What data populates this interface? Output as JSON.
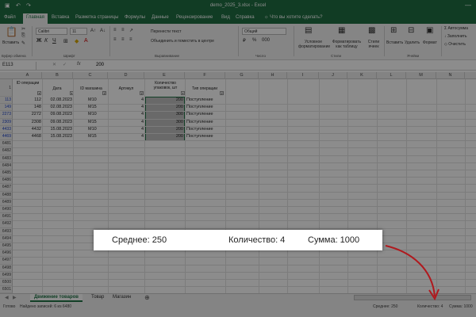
{
  "window": {
    "title": "demo_2025_3.xlsx  -  Excel",
    "minimize": "—"
  },
  "ribbon_tabs": [
    "Файл",
    "Главная",
    "Вставка",
    "Разметка страницы",
    "Формулы",
    "Данные",
    "Рецензирование",
    "Вид",
    "Справка"
  ],
  "tell_me": "Что вы хотите сделать?",
  "ribbon": {
    "paste": "Вставить",
    "font_name": "Calibri",
    "font_size": "11",
    "wrap_text": "Перенести текст",
    "merge": "Объединить и поместить в центре",
    "number_format": "Общий",
    "conditional": "Условное форматирование",
    "format_table": "Форматировать как таблицу",
    "cell_styles": "Стили ячеек",
    "insert": "Вставить",
    "delete": "Удалить",
    "format": "Формат",
    "autosum": "Автосумма",
    "fill": "Заполнить",
    "clear": "Очистить",
    "groups": {
      "clipboard": "Буфер обмена",
      "font": "Шрифт",
      "alignment": "Выравнивание",
      "number": "Число",
      "styles": "Стили",
      "cells": "Ячейки"
    }
  },
  "formula_bar": {
    "name_box": "E113",
    "fx": "fx",
    "value": "200"
  },
  "columns": [
    "A",
    "B",
    "C",
    "D",
    "E",
    "F",
    "G",
    "H",
    "I",
    "J",
    "K",
    "L",
    "M",
    "N",
    "O",
    "P"
  ],
  "headers": {
    "a": "ID операции",
    "b": "Дата",
    "c": "ID магазина",
    "d": "Артикул",
    "e": "Количество упаковок, шт",
    "f": "Тип операции"
  },
  "rows": [
    {
      "num": "113",
      "a": "112",
      "b": "02.08.2023",
      "c": "M10",
      "d": "4",
      "e": "200",
      "f": "Поступление"
    },
    {
      "num": "149",
      "a": "148",
      "b": "02.08.2023",
      "c": "M15",
      "d": "4",
      "e": "200",
      "f": "Поступление"
    },
    {
      "num": "2273",
      "a": "2272",
      "b": "09.08.2023",
      "c": "M10",
      "d": "4",
      "e": "300",
      "f": "Поступление"
    },
    {
      "num": "2309",
      "a": "2308",
      "b": "09.08.2023",
      "c": "M15",
      "d": "4",
      "e": "300",
      "f": "Поступление"
    },
    {
      "num": "4433",
      "a": "4432",
      "b": "15.08.2023",
      "c": "M10",
      "d": "4",
      "e": "200",
      "f": "Поступление"
    },
    {
      "num": "4469",
      "a": "4468",
      "b": "15.08.2023",
      "c": "M15",
      "d": "4",
      "e": "200",
      "f": "Поступление"
    }
  ],
  "empty_rows": [
    "6481",
    "6482",
    "6483",
    "6484",
    "6485",
    "6486",
    "6487",
    "6488",
    "6489",
    "6490",
    "6491",
    "6492",
    "6493",
    "6494",
    "6495",
    "6496",
    "6497",
    "6498",
    "6499",
    "6500",
    "6501",
    "6502",
    "6503"
  ],
  "sheet_tabs": [
    "Движение товаров",
    "Товар",
    "Магазин"
  ],
  "status": {
    "ready": "Готово",
    "found": "Найдено записей: 6 из 6480",
    "average": "Среднее: 250",
    "count": "Количество: 4",
    "sum": "Сумма: 1000"
  },
  "zoom_panel": {
    "average": "Среднее: 250",
    "count": "Количество: 4",
    "sum": "Сумма: 1000"
  },
  "colors": {
    "excel_green": "#1f6e43",
    "selection": "#bfbfbf",
    "arrow": "#b0191e",
    "row_blue": "#1e44c8"
  }
}
